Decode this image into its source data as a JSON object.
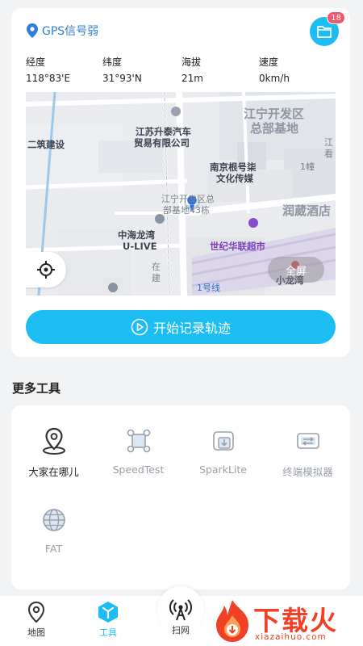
{
  "gps": {
    "label": "GPS信号弱",
    "icon": "location-pin-icon"
  },
  "folder": {
    "icon": "folder-icon",
    "badge": "18"
  },
  "stats": [
    {
      "key": "经度",
      "value": "118°83'E"
    },
    {
      "key": "纬度",
      "value": "31°93'N"
    },
    {
      "key": "海拔",
      "value": "21m"
    },
    {
      "key": "速度",
      "value": "0km/h"
    }
  ],
  "map": {
    "labels": {
      "jiangning_zone": "江宁开发区",
      "hq_base": "总部基地",
      "jiangsu_auto_1": "江苏升泰汽车",
      "jiangsu_auto_2": "贸易有限公司",
      "construction": "二筑建设",
      "media_1": "南京根号柒",
      "media_2": "文化传媒",
      "building_1": "1幢",
      "hq_43_1": "江宁开发区总",
      "hq_43_2": "部基地43栋",
      "hotel": "润葳酒店",
      "zhonghai_1": "中海龙湾",
      "zhonghai_2": "U-LIVE",
      "supermarket": "世纪华联超市",
      "under_1": "在",
      "under_2": "建",
      "line1": "1号线",
      "xiaolongwan": "小龙湾",
      "jiang_edge_1": "江",
      "jiang_edge_2": "看",
      "left_edge": "宫"
    },
    "fullscreen": "全屏",
    "locate_icon": "crosshair-icon"
  },
  "record": {
    "label": "开始记录轨迹",
    "icon": "play-circle-icon"
  },
  "tools_title": "更多工具",
  "tools": [
    {
      "label": "大家在哪儿",
      "icon": "location-ring-icon"
    },
    {
      "label": "SpeedTest",
      "icon": "speedtest-icon"
    },
    {
      "label": "SparkLite",
      "icon": "sparklite-icon"
    },
    {
      "label": "终端模拟器",
      "icon": "terminal-sim-icon"
    },
    {
      "label": "FAT",
      "icon": "globe-icon"
    }
  ],
  "tabs": {
    "map": "地图",
    "tools": "工具",
    "scan": "扫网"
  },
  "watermark": {
    "text": "下载火",
    "url": "xiazaihuo.com"
  },
  "colors": {
    "accent": "#1bbdf2",
    "badge": "#f2566d",
    "gps": "#2f7fd9"
  }
}
